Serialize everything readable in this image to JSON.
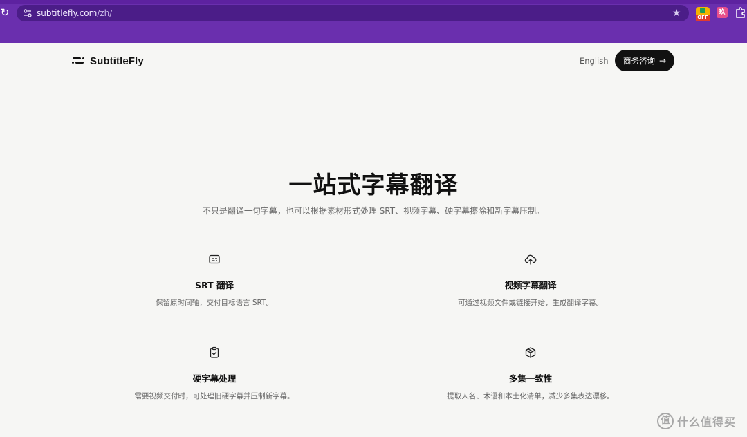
{
  "browser": {
    "url_host": "subtitlefly.com",
    "url_path": "/zh/",
    "extension_off_label": "OFF",
    "extension_pink_label": "玖"
  },
  "header": {
    "brand": "SubtitleFly",
    "language_link": "English",
    "cta_label": "商务咨询",
    "cta_arrow": "→"
  },
  "hero": {
    "title": "一站式字幕翻译",
    "subtitle": "不只是翻译一句字幕，也可以根据素材形式处理 SRT、视频字幕、硬字幕擦除和新字幕压制。"
  },
  "features": [
    {
      "icon": "subtitles-icon",
      "title": "SRT 翻译",
      "description": "保留原时间轴，交付目标语言 SRT。"
    },
    {
      "icon": "cloud-upload-icon",
      "title": "视频字幕翻译",
      "description": "可通过视频文件或链接开始，生成翻译字幕。"
    },
    {
      "icon": "clipboard-check-icon",
      "title": "硬字幕处理",
      "description": "需要视频交付时，可处理旧硬字幕并压制新字幕。"
    },
    {
      "icon": "package-icon",
      "title": "多集一致性",
      "description": "提取人名、术语和本土化清单，减少多集表达漂移。"
    }
  ],
  "watermark": {
    "glyph": "值",
    "text": "什么值得买"
  },
  "colors": {
    "browser_bar": "#6a2fae",
    "page_background": "#f6f6f4",
    "cta_background": "#111111"
  }
}
